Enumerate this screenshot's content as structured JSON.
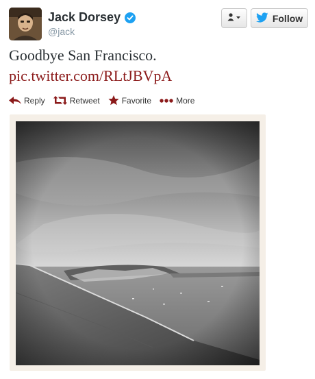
{
  "user": {
    "name": "Jack Dorsey",
    "handle": "@jack",
    "verified": true
  },
  "buttons": {
    "user_menu_icon": "user-dropdown-icon",
    "follow_label": "Follow",
    "follow_icon": "twitter-bird-icon"
  },
  "tweet": {
    "text": "Goodbye San Francisco.",
    "link": "pic.twitter.com/RLtJBVpA"
  },
  "actions": {
    "reply": "Reply",
    "retweet": "Retweet",
    "favorite": "Favorite",
    "more": "More"
  },
  "colors": {
    "link": "#8b1a1a",
    "action_icon": "#8b1a1a",
    "verified": "#1da1f2",
    "follow_bird": "#1da1f2"
  }
}
